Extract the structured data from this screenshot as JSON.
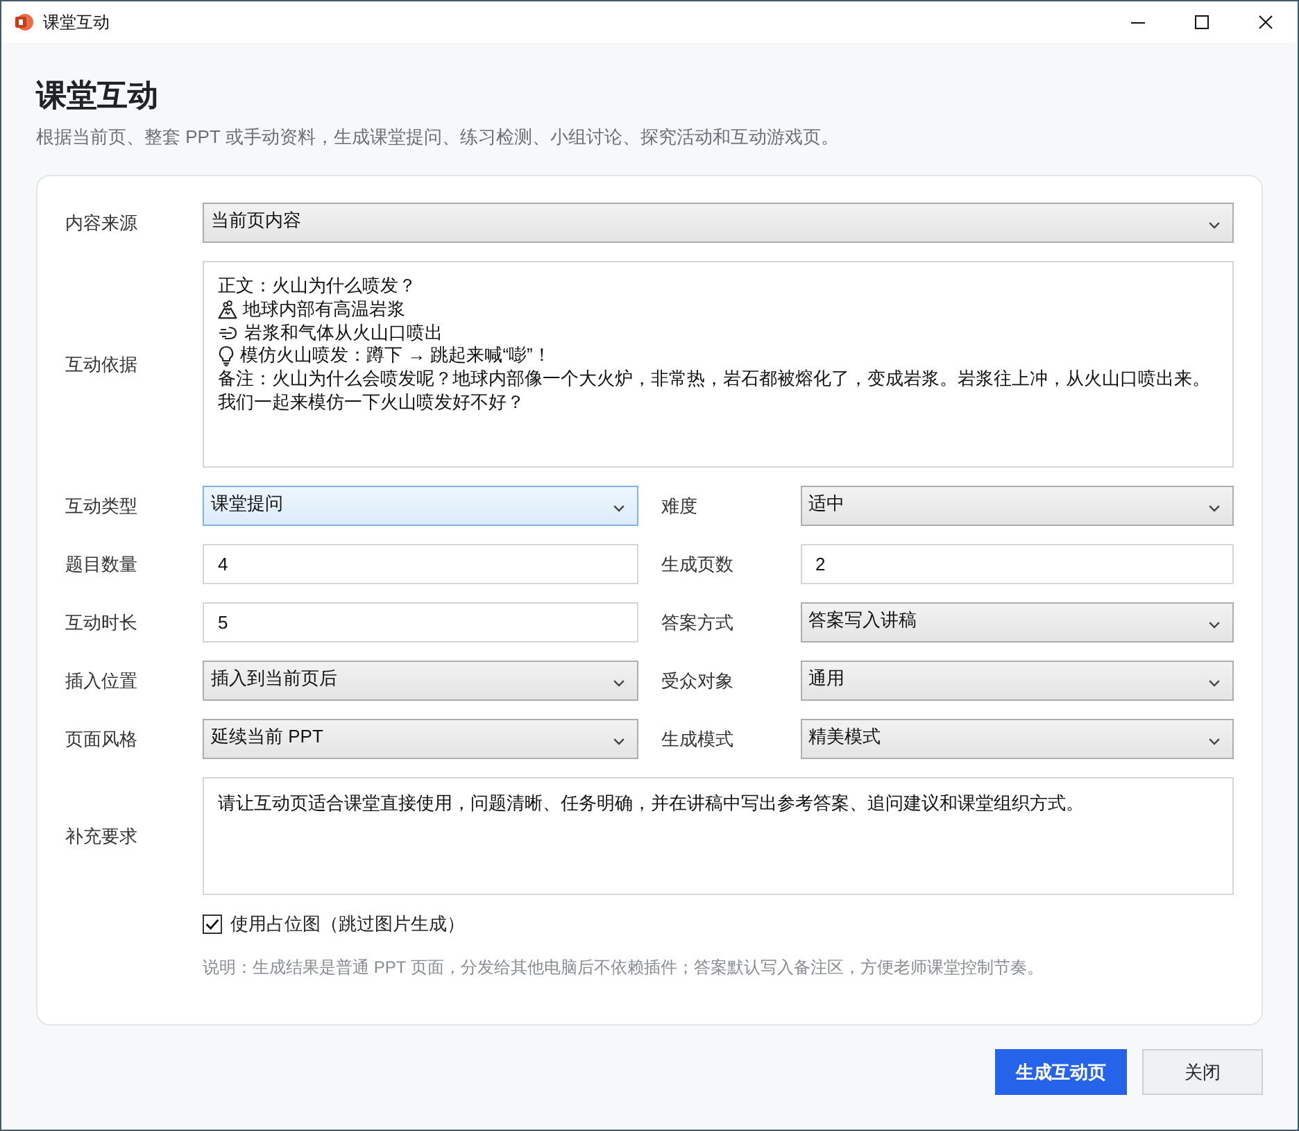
{
  "window": {
    "title": "课堂互动"
  },
  "header": {
    "title": "课堂互动",
    "subtitle": "根据当前页、整套 PPT 或手动资料，生成课堂提问、练习检测、小组讨论、探究活动和互动游戏页。"
  },
  "form": {
    "source": {
      "label": "内容来源",
      "value": "当前页内容",
      "focused": false
    },
    "basis": {
      "label": "互动依据",
      "lines": [
        {
          "kind": "text",
          "text": "正文：火山为什么喷发？"
        },
        {
          "kind": "icon",
          "text": "地球内部有高温岩浆"
        },
        {
          "kind": "icon",
          "text": "岩浆和气体从火山口喷出"
        },
        {
          "kind": "icon",
          "text": "模仿火山喷发：蹲下 → 跳起来喊“嘭”！"
        },
        {
          "kind": "text",
          "text": "备注：火山为什么会喷发呢？地球内部像一个大火炉，非常热，岩石都被熔化了，变成岩浆。岩浆往上冲，从火山口喷出来。"
        },
        {
          "kind": "text",
          "text": "我们一起来模仿一下火山喷发好不好？"
        }
      ]
    },
    "fields": [
      {
        "label": "互动类型",
        "kind": "select",
        "value": "课堂提问",
        "focused": true
      },
      {
        "label": "难度",
        "kind": "select",
        "value": "适中",
        "focused": false
      },
      {
        "label": "题目数量",
        "kind": "input",
        "value": "4"
      },
      {
        "label": "生成页数",
        "kind": "input",
        "value": "2"
      },
      {
        "label": "互动时长",
        "kind": "input",
        "value": "5"
      },
      {
        "label": "答案方式",
        "kind": "select",
        "value": "答案写入讲稿",
        "focused": false
      },
      {
        "label": "插入位置",
        "kind": "select",
        "value": "插入到当前页后",
        "focused": false
      },
      {
        "label": "受众对象",
        "kind": "select",
        "value": "通用",
        "focused": false
      },
      {
        "label": "页面风格",
        "kind": "select",
        "value": "延续当前 PPT",
        "focused": false
      },
      {
        "label": "生成模式",
        "kind": "select",
        "value": "精美模式",
        "focused": false
      }
    ],
    "extra": {
      "label": "补充要求",
      "value": "请让互动页适合课堂直接使用，问题清晰、任务明确，并在讲稿中写出参考答案、追问建议和课堂组织方式。"
    },
    "placeholder_option": {
      "label": "使用占位图（跳过图片生成）",
      "checked": true
    },
    "note": "说明：生成结果是普通 PPT 页面，分发给其他电脑后不依赖插件；答案默认写入备注区，方便老师课堂控制节奏。"
  },
  "buttons": [
    {
      "label": "生成互动页",
      "kind": "primary"
    },
    {
      "label": "关闭",
      "kind": "secondary"
    }
  ]
}
